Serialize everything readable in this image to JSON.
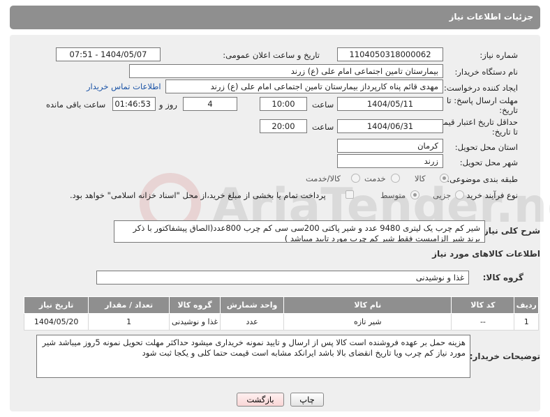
{
  "header": {
    "title": "جزئیات اطلاعات نیاز"
  },
  "fields": {
    "need_number_label": "شماره نیاز:",
    "need_number": "1104050318000062",
    "announce_label": "تاریخ و ساعت اعلان عمومی:",
    "announce_value": "1404/05/07 - 07:51",
    "buyer_org_label": "نام دستگاه خریدار:",
    "buyer_org": "بیمارستان تامین اجتماعی امام علی (ع) زرند",
    "requester_label": "ایجاد کننده درخواست:",
    "requester": "مهدی  قائم پناه  کارپرداز بیمارستان تامین اجتماعی امام علی (ع) زرند",
    "contact_link": "اطلاعات تماس خریدار",
    "deadline_label_1": "مهلت ارسال پاسخ: تا",
    "deadline_label_2": "تاریخ:",
    "deadline_date": "1404/05/11",
    "time_label": "ساعت",
    "deadline_time": "10:00",
    "days_value": "4",
    "days_label": "روز و",
    "remaining_value": "01:46:53",
    "remaining_label": "ساعت باقی مانده",
    "validity_label_1": "حداقل تاریخ اعتبار قیمت:",
    "validity_label_2": "تا تاریخ:",
    "validity_date": "1404/06/31",
    "validity_time": "20:00",
    "province_label": "استان محل تحویل:",
    "province": "کرمان",
    "city_label": "شهر محل تحویل:",
    "city": "زرند",
    "category_label": "طبقه بندی موضوعی:",
    "category_options": [
      "کالا",
      "خدمت",
      "کالا/خدمت"
    ],
    "process_label": "نوع فرآیند خرید :",
    "process_options": [
      "جزیی",
      "متوسط"
    ],
    "payment_note": "پرداخت تمام یا بخشی از مبلغ خرید،از محل \"اسناد خزانه اسلامی\" خواهد بود."
  },
  "description": {
    "label": "شرح کلی نیاز:",
    "text": "شیر کم چرب یک لیتری 9480 عدد و شیر پاکتی 200سی سی کم چرب 800عدد(الصاق پیشفاکتور با ذکر برند شیر الزامیست فقط شیر کم چرب مورد تایید میباشد )"
  },
  "goods": {
    "section_title": "اطلاعات کالاهای مورد نیاز",
    "group_label": "گروه کالا:",
    "group_value": "غذا و نوشیدنی",
    "columns": [
      "ردیف",
      "کد کالا",
      "نام کالا",
      "واحد شمارش",
      "گروه کالا",
      "تعداد / مقدار",
      "تاریخ نیاز"
    ],
    "rows": [
      [
        "1",
        "--",
        "شیر تازه",
        "عدد",
        "غذا و نوشیدنی",
        "1",
        "1404/05/20"
      ]
    ]
  },
  "buyer_notes": {
    "label": "توضیحات خریدار:",
    "text": "هزینه حمل بر عهده فروشنده است کالا پس از ارسال و تایید نمونه خریداری میشود حداکثر مهلت تحویل نمونه 5روز میباشد شیر مورد نیاز کم چرب ویا تاریخ انقضای بالا باشد ایرانکد مشابه است قیمت حتما کلی و یکجا ثبت شود"
  },
  "buttons": {
    "print": "چاپ",
    "back": "بازگشت"
  },
  "watermark": {
    "text": "AriaTender.neT"
  }
}
